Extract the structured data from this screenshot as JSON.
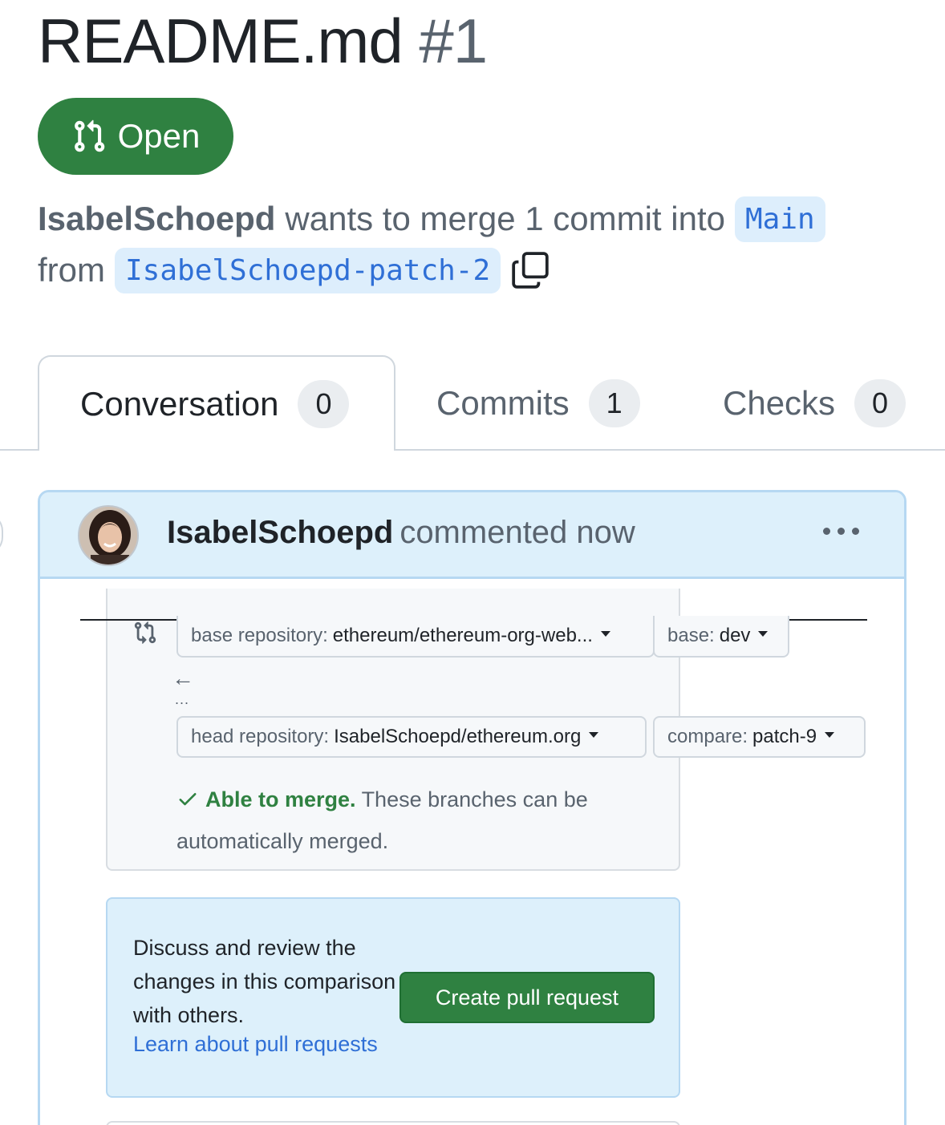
{
  "pr": {
    "title": "README.md",
    "number": "#1",
    "state": "Open",
    "author": "IsabelSchoepd",
    "merge_text": "wants to merge 1 commit into",
    "base_branch": "Main",
    "from_text": "from",
    "head_branch": "IsabelSchoepd-patch-2"
  },
  "tabs": [
    {
      "label": "Conversation",
      "count": "0"
    },
    {
      "label": "Commits",
      "count": "1"
    },
    {
      "label": "Checks",
      "count": "0"
    }
  ],
  "comment": {
    "author": "IsabelSchoepd",
    "meta": "commented now",
    "embed": {
      "base_repo_label": "base repository:",
      "base_repo_value": "ethereum/ethereum-org-web...",
      "base_label": "base:",
      "base_value": "dev",
      "arrow": "←",
      "dots": "...",
      "head_repo_label": "head repository:",
      "head_repo_value": "IsabelSchoepd/ethereum.org",
      "compare_label": "compare:",
      "compare_value": "patch-9",
      "merge_ok": "Able to merge.",
      "merge_rest": "These branches can be automatically merged.",
      "discuss_text": "Discuss and review the changes in this comparison with others.",
      "learn_link": "Learn about pull requests",
      "create_button": "Create pull request"
    }
  },
  "colors": {
    "open_green": "#2f8141",
    "link_blue": "#2f6fd6",
    "header_blue": "#ddf0fb",
    "border_blue": "#b6d8f2"
  },
  "icons": {
    "state": "git-pull-request-icon",
    "copy": "copy-icon",
    "menu": "kebab-horizontal-icon",
    "compare": "git-compare-icon",
    "check": "check-icon"
  }
}
